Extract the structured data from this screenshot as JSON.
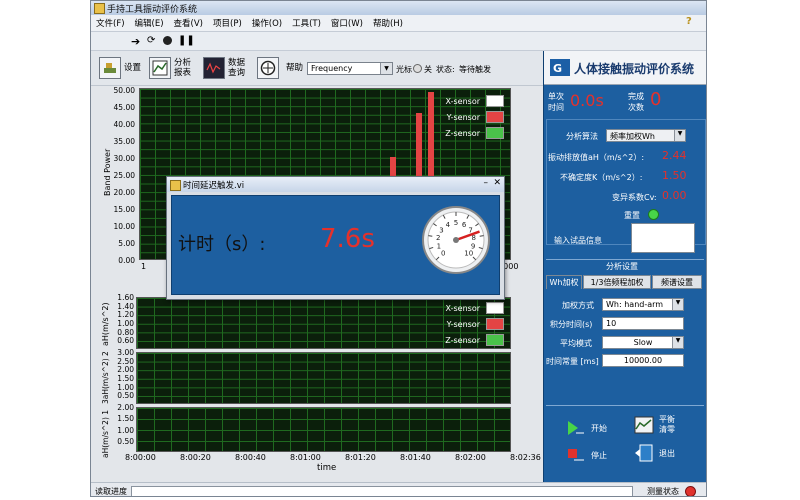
{
  "window": {
    "title": "手持工具振动评价系统"
  },
  "menu": [
    "文件(F)",
    "编辑(E)",
    "查看(V)",
    "项目(P)",
    "操作(O)",
    "工具(T)",
    "窗口(W)",
    "帮助(H)"
  ],
  "toolbar": {
    "settings_label": "设置",
    "analysis_label_1": "分析",
    "analysis_label_2": "报表",
    "data_label_1": "数据",
    "data_label_2": "查询",
    "help_label": "帮助",
    "freq_value": "Frequency",
    "cursor_label": "光标",
    "cursor_state": "关",
    "status_label": "状态:",
    "status_value": "等待触发"
  },
  "top_chart": {
    "ylabel": "Band Power",
    "yticks": [
      "50.00",
      "45.00",
      "40.00",
      "35.00",
      "30.00",
      "25.00",
      "20.00",
      "15.00",
      "10.00",
      "5.00",
      "0.00"
    ],
    "x_start": "1",
    "x_end": "10000",
    "legend": [
      "X-sensor",
      "Y-sensor",
      "Z-sensor"
    ]
  },
  "lower_chart": {
    "ylabel_1": "aH(m/s^2)",
    "ylabel_2": "3aH(m/s^2) 2",
    "ylabel_3": "aH(m/s^2) 1",
    "yticks_1": [
      "1.60",
      "1.40",
      "1.20",
      "1.00",
      "0.80",
      "0.60"
    ],
    "yticks_2": [
      "3.00",
      "2.50",
      "2.00",
      "1.50",
      "1.00",
      "0.50"
    ],
    "yticks_3": [
      "2.00",
      "1.50",
      "1.00",
      "0.50"
    ],
    "legend": [
      "X-sensor",
      "Y-sensor",
      "Z-sensor"
    ],
    "xticks": [
      "8:00:00",
      "8:00:20",
      "8:00:40",
      "8:01:00",
      "8:01:20",
      "8:01:40",
      "8:02:00",
      "8:02:36"
    ],
    "xlabel": "time"
  },
  "right_panel": {
    "title": "人体接触振动评价系统",
    "single_label_1": "单次",
    "single_label_2": "时间",
    "single_value": "0.0s",
    "done_label_1": "完成",
    "done_label_2": "次数",
    "done_value": "0",
    "algo_label": "分析算法",
    "algo_value": "频率加权Wh",
    "emission_label": "振动排放值aH（m/s^2）:",
    "emission_value": "2.44",
    "uncert_label": "不确定度K（m/s^2）:",
    "uncert_value": "1.50",
    "cv_label": "变异系数Cv:",
    "cv_value": "0.00",
    "reset_label": "重置",
    "sample_label": "输入试品信息",
    "sample_value": "",
    "section_label": "分析设置",
    "tabs": [
      "Wh加权",
      "1/3倍频程加权",
      "频谱设置"
    ],
    "weight_label": "加权方式",
    "weight_value": "Wh: hand-arm",
    "integ_label": "积分时间(s)",
    "integ_value": "10",
    "avg_label": "平均模式",
    "avg_value": "Slow",
    "tconst_label": "时间常量 [ms]",
    "tconst_value": "10000.00",
    "start_label": "开始",
    "zero_label_1": "平衡",
    "zero_label_2": "清零",
    "stop_label": "停止",
    "exit_label": "退出"
  },
  "statusbar": {
    "progress_label": "读取进度",
    "measure_label": "测量状态"
  },
  "dialog": {
    "title": "时间延迟触发.vi",
    "timer_label": "计时（s）:",
    "timer_value": "7.6s",
    "dial_ticks": [
      "0",
      "1",
      "2",
      "3",
      "4",
      "5",
      "6",
      "7",
      "8",
      "9",
      "10"
    ],
    "dial_value": 7.6
  },
  "colors": {
    "panel_blue": "#1d5fa0",
    "value_red": "#e5312b",
    "plot_bg": "#0b1f0b",
    "bar_red": "#e34444"
  },
  "chart_data": {
    "type": "bar",
    "ylabel": "Band Power",
    "ylim": [
      0,
      50
    ],
    "xlim": [
      1,
      10000
    ],
    "bars": [
      {
        "y": 30
      },
      {
        "y": 43
      },
      {
        "y": 49
      }
    ],
    "series_legend": [
      "X-sensor",
      "Y-sensor",
      "Z-sensor"
    ]
  }
}
